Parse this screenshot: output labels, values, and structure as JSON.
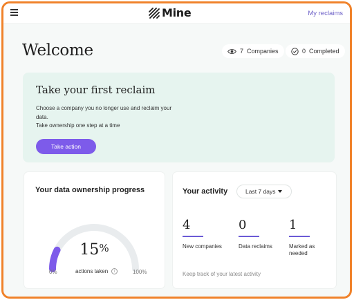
{
  "header": {
    "logo_text": "Mine",
    "my_reclaims": "My reclaims",
    "menu_icon": "hamburger-menu-icon",
    "logo_icon": "mine-logo-icon"
  },
  "welcome": {
    "title": "Welcome",
    "companies": {
      "icon": "eye-icon",
      "count": "7",
      "label": "Companies"
    },
    "completed": {
      "icon": "check-circle-icon",
      "count": "0",
      "label": "Completed"
    }
  },
  "hero": {
    "title": "Take your first reclaim",
    "desc_line1": "Choose a company you no longer use and reclaim your data.",
    "desc_line2": "Take ownership one step at a time",
    "button": "Take action"
  },
  "progress": {
    "title": "Your data ownership progress",
    "percent": "15",
    "percent_symbol": "%",
    "value_fraction": 0.15,
    "min_label": "0%",
    "max_label": "100%",
    "actions_label": "actions taken",
    "track_color": "#e9ecee",
    "fill_color": "#7d5bea"
  },
  "activity": {
    "title": "Your activity",
    "range": "Last 7 days",
    "metrics": [
      {
        "value": "4",
        "label": "New companies"
      },
      {
        "value": "0",
        "label": "Data reclaims"
      },
      {
        "value": "1",
        "label": "Marked as needed"
      }
    ],
    "footer": "Keep track of your latest activity"
  },
  "colors": {
    "accent": "#7d5bea",
    "frame_border": "#f0822a",
    "hero_bg": "#e6f4ef"
  }
}
